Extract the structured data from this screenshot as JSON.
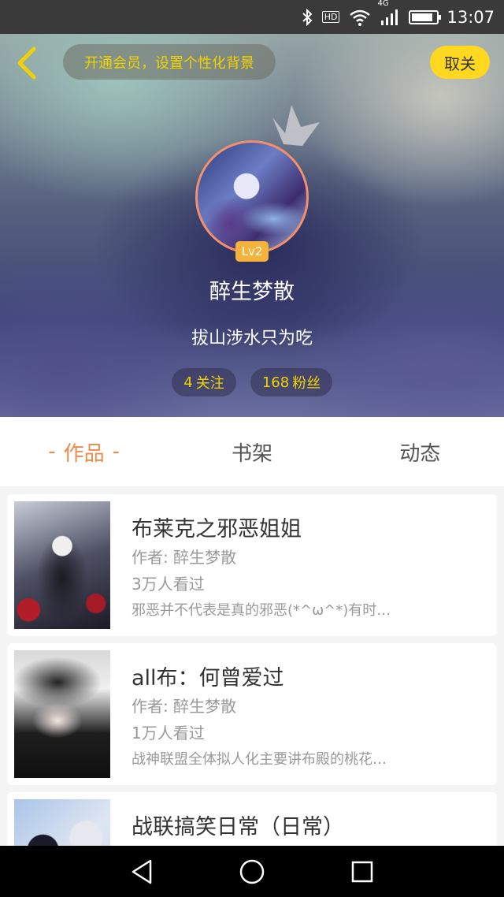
{
  "status_bar": {
    "hd_label": "HD",
    "network_label": "4G",
    "time": "13:07",
    "battery_level": 0.85,
    "icons": [
      "bluetooth-icon",
      "wifi-icon",
      "signal-icon",
      "battery-icon"
    ]
  },
  "header": {
    "back_icon": "chevron-left-icon",
    "vip_banner": "开通会员，设置个性化背景",
    "unfollow_label": "取关"
  },
  "profile": {
    "level": "Lv2",
    "username": "醉生梦散",
    "signature": "拔山涉水只为吃",
    "following_count": "4",
    "following_label": "关注",
    "fans_count": "168",
    "fans_label": "粉丝"
  },
  "tabs": [
    {
      "label": "作品",
      "active": true
    },
    {
      "label": "书架",
      "active": false
    },
    {
      "label": "动态",
      "active": false
    }
  ],
  "works": [
    {
      "title": "布莱克之邪恶姐姐",
      "author": "作者: 醉生梦散",
      "views": "3万人看过",
      "description": "邪恶并不代表是真的邪恶(*^ω^*)有时…"
    },
    {
      "title": "all布：何曾爱过",
      "author": "作者: 醉生梦散",
      "views": "1万人看过",
      "description": "战神联盟全体拟人化主要讲布殿的桃花…"
    },
    {
      "title": "战联搞笑日常（日常）",
      "author": "",
      "views": "",
      "description": ""
    }
  ],
  "nav_bar": {
    "icons": [
      "back-triangle-icon",
      "home-circle-icon",
      "recents-square-icon"
    ]
  },
  "colors": {
    "accent_orange": "#f08a4b",
    "yellow": "#ffd81f",
    "vip_text": "#f2d100",
    "level_badge": "#f4b33a"
  }
}
